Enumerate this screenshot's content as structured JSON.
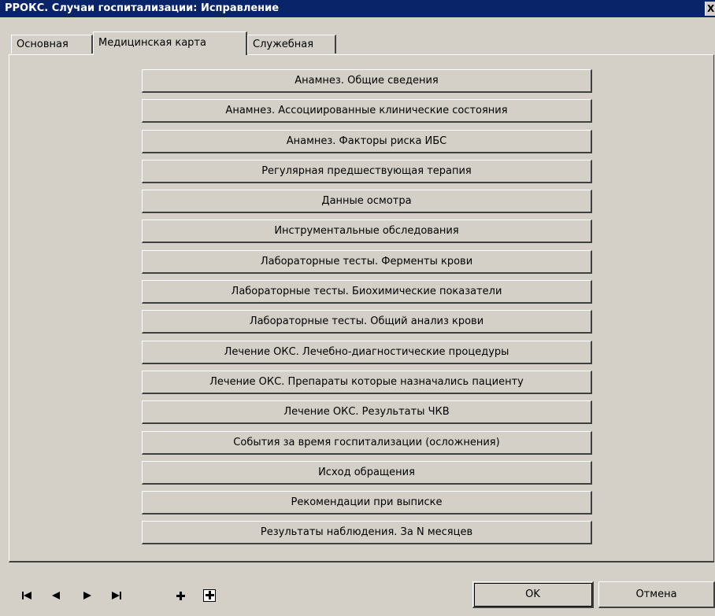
{
  "window": {
    "title": "РРОКС. Случаи госпитализации: Исправление",
    "close_label": "X"
  },
  "tabs": [
    {
      "label": "Основная"
    },
    {
      "label": "Медицинская карта"
    },
    {
      "label": "Служебная"
    }
  ],
  "active_tab": "Медицинская карта",
  "sections": [
    {
      "label": "Анамнез. Общие сведения"
    },
    {
      "label": "Анамнез. Ассоциированные клинические состояния"
    },
    {
      "label": "Анамнез. Факторы риска ИБС"
    },
    {
      "label": "Регулярная предшествующая терапия"
    },
    {
      "label": "Данные осмотра"
    },
    {
      "label": "Инструментальные обследования"
    },
    {
      "label": "Лабораторные тесты. Ферменты крови"
    },
    {
      "label": "Лабораторные тесты. Биохимические показатели"
    },
    {
      "label": "Лабораторные тесты. Общий анализ крови"
    },
    {
      "label": "Лечение ОКС. Лечебно-диагностические процедуры"
    },
    {
      "label": "Лечение ОКС. Препараты которые назначались пациенту"
    },
    {
      "label": "Лечение ОКС. Результаты ЧКВ"
    },
    {
      "label": "События за время госпитализации (осложнения)"
    },
    {
      "label": "Исход обращения"
    },
    {
      "label": "Рекомендации при выписке"
    },
    {
      "label": "Результаты наблюдения. За N месяцев"
    }
  ],
  "navigator": {
    "first": "first-record-icon",
    "prev": "prev-record-icon",
    "next": "next-record-icon",
    "last": "last-record-icon",
    "add": "add-record-icon",
    "add_box": "add-record-box-icon"
  },
  "footer": {
    "ok_label": "OK",
    "cancel_label": "Отмена"
  },
  "colors": {
    "titlebar": "#0a246a",
    "face": "#d4d0c8"
  }
}
